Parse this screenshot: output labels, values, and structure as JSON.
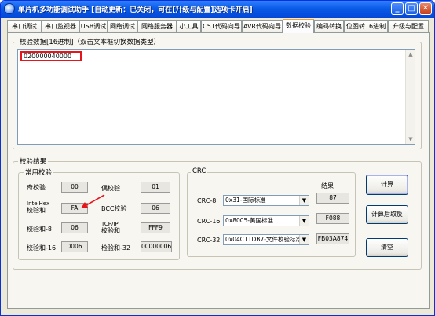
{
  "window": {
    "title": "单片机多功能调试助手 [自动更新：已关闭，可在[升级与配置]选项卡开启]",
    "controls": {
      "minimize": "_",
      "maximize": "□",
      "close": "✕"
    }
  },
  "tabs": [
    {
      "label": "串口调试"
    },
    {
      "label": "串口监视器"
    },
    {
      "label": "USB调试"
    },
    {
      "label": "网络调试"
    },
    {
      "label": "网络服务器"
    },
    {
      "label": "小工具"
    },
    {
      "label": "C51代码向导"
    },
    {
      "label": "AVR代码向导"
    },
    {
      "label": "数据校验",
      "active": true
    },
    {
      "label": "编码转换"
    },
    {
      "label": "位图转16进制"
    },
    {
      "label": "升级与配置"
    }
  ],
  "input": {
    "legend": "校验数据[16进制]（双击文本框切换数据类型）",
    "value": "020000040000"
  },
  "results": {
    "legend": "校验结果",
    "common": {
      "legend": "常用校验",
      "odd_label": "奇校验",
      "odd_value": "00",
      "even_label": "偶校验",
      "even_value": "01",
      "intelhex_label_1": "IntelHex",
      "intelhex_label_2": "校验和",
      "intelhex_value": "FA",
      "bcc_label": "BCC校验",
      "bcc_value": "06",
      "sum8_label": "校验和-8",
      "sum8_value": "06",
      "tcpip_label_1": "TCP/IP",
      "tcpip_label_2": "校验和",
      "tcpip_value": "FFF9",
      "sum16_label": "校验和-16",
      "sum16_value": "0006",
      "sum32_label": "检验和-32",
      "sum32_value": "00000006"
    },
    "crc": {
      "legend": "CRC",
      "result_header": "结果",
      "crc8_label": "CRC-8",
      "crc8_select": "0x31-国际标准",
      "crc8_value": "87",
      "crc16_label": "CRC-16",
      "crc16_select": "0x8005-美国标准",
      "crc16_value": "F088",
      "crc32_label": "CRC-32",
      "crc32_select": "0x04C11DB7-文件校验标准",
      "crc32_value": "FB03A874"
    }
  },
  "buttons": {
    "compute": "计算",
    "compute_reverse": "计算后取反",
    "clear": "清空"
  },
  "icons": {
    "app": "app-chip-icon",
    "dropdown": "chevron-down-icon",
    "scroll_up": "scroll-up-arrow-icon",
    "scroll_down": "scroll-down-arrow-icon",
    "pointer": "red-arrow-annotation"
  },
  "colors": {
    "titlebar": "#0a5ae6",
    "highlight": "#e8141b",
    "annotation_arrow": "#e8141b"
  }
}
